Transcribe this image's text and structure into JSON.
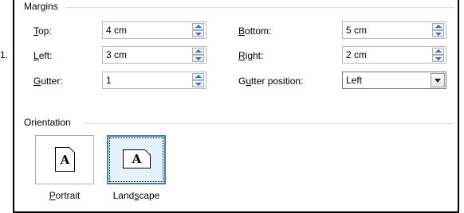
{
  "outside_marker": "1.",
  "margins": {
    "group_title": "Margins",
    "top": {
      "label_mnemonic": "T",
      "label_rest": "op:",
      "value": "4 cm"
    },
    "left": {
      "label_mnemonic": "L",
      "label_rest": "eft:",
      "value": "3 cm"
    },
    "gutter": {
      "label_mnemonic": "G",
      "label_rest": "utter:",
      "value": "1"
    },
    "bottom": {
      "label_mnemonic": "B",
      "label_rest": "ottom:",
      "value": "5 cm"
    },
    "right": {
      "label_mnemonic": "R",
      "label_rest": "ight:",
      "value": "2 cm"
    },
    "gutter_position": {
      "label_pre": "G",
      "label_mnemonic": "u",
      "label_rest": "tter position:",
      "value": "Left"
    }
  },
  "orientation": {
    "group_title": "Orientation",
    "portrait": {
      "label_mnemonic": "P",
      "label_rest": "ortrait",
      "icon_letter": "A",
      "selected": false
    },
    "landscape": {
      "label_pre": "Land",
      "label_mnemonic": "s",
      "label_rest": "cape",
      "icon_letter": "A",
      "selected": true
    }
  },
  "colors": {
    "spin_arrow": "#3a6cb4",
    "selected_border": "#3c7fb1",
    "selected_fill": "#e5f1fb"
  }
}
